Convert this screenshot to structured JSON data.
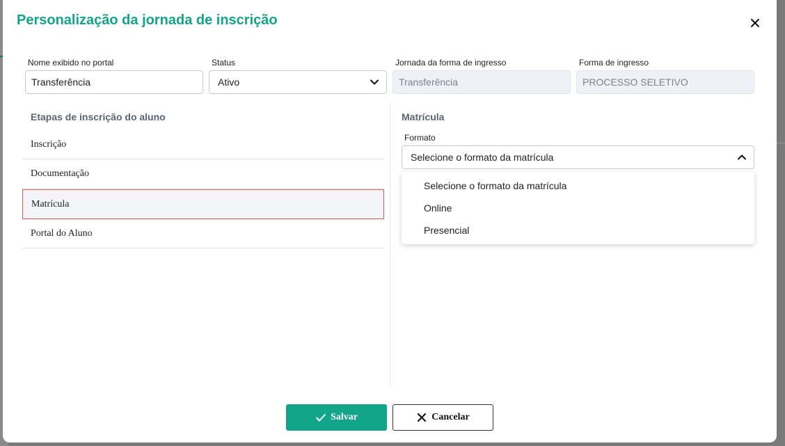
{
  "modal": {
    "title": "Personalização da jornada de inscrição"
  },
  "fields": {
    "nome": {
      "label": "Nome exibido no portal",
      "value": "Transferência"
    },
    "status": {
      "label": "Status",
      "value": "Ativo"
    },
    "jornada": {
      "label": "Jornada da forma de ingresso",
      "value": "Transferência"
    },
    "forma": {
      "label": "Forma de ingresso",
      "value": "PROCESSO SELETIVO"
    }
  },
  "stages": {
    "title": "Etapas de inscrição do aluno",
    "items": [
      {
        "label": "Inscrição"
      },
      {
        "label": "Documentação"
      },
      {
        "label": "Matrícula"
      },
      {
        "label": "Portal do Aluno"
      }
    ],
    "active_index": 2
  },
  "matricula": {
    "title": "Matrícula",
    "format_label": "Formato",
    "format_value": "Selecione o formato da matrícula",
    "options": [
      "Selecione o formato da matrícula",
      "Online",
      "Presencial"
    ]
  },
  "actions": {
    "save_label": "Salvar",
    "cancel_label": "Cancelar"
  },
  "colors": {
    "accent": "#12a58a",
    "active_border": "#e0554f"
  },
  "icons": {
    "close": "close-icon",
    "chevron_down": "chevron-down-icon",
    "chevron_up": "chevron-up-icon",
    "check": "check-icon",
    "x": "x-icon"
  }
}
